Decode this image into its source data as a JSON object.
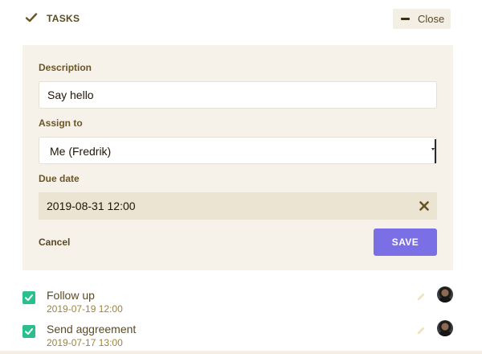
{
  "header": {
    "title": "TASKS",
    "close_label": "Close",
    "icons": {
      "title_icon": "check-icon",
      "close_icon": "minus-icon"
    }
  },
  "form": {
    "description_label": "Description",
    "description_value": "Say hello",
    "assign_label": "Assign to",
    "assign_value": "Me (Fredrik)",
    "due_label": "Due date",
    "due_value": "2019-08-31 12:00",
    "cancel_label": "Cancel",
    "save_label": "SAVE"
  },
  "tasks": [
    {
      "title": "Follow up",
      "date": "2019-07-19 12:00",
      "done": true
    },
    {
      "title": "Send aggreement",
      "date": "2019-07-17 13:00",
      "done": true
    }
  ],
  "colors": {
    "accent": "#7b6fe6",
    "check": "#2bbf8e",
    "panel": "#f6f2ea",
    "date_field": "#ebe4d2"
  }
}
